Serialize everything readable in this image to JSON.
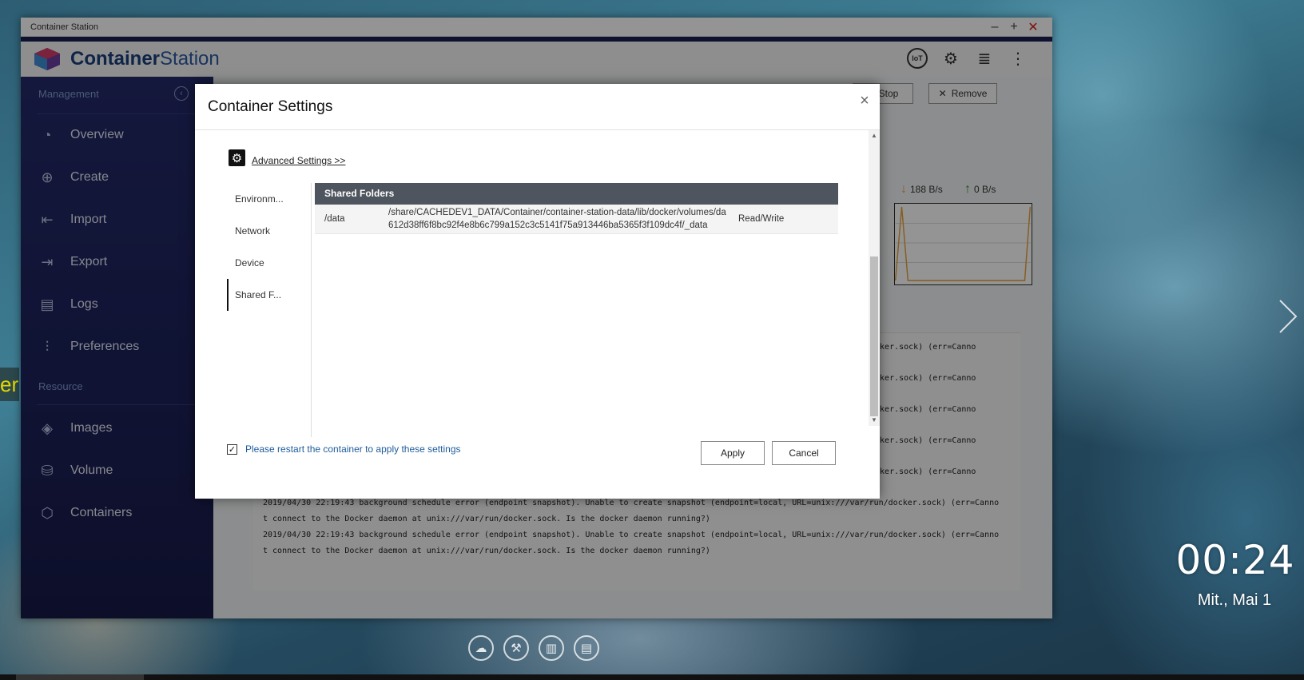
{
  "window": {
    "title": "Container Station"
  },
  "app": {
    "brand_bold": "Container",
    "brand_light": "Station"
  },
  "header": {
    "iot_label": "IoT"
  },
  "sidebar": {
    "section_management": "Management",
    "section_resource": "Resource",
    "items": [
      {
        "label": "Overview",
        "icon": "gauge-icon"
      },
      {
        "label": "Create",
        "icon": "plus-circle-icon"
      },
      {
        "label": "Import",
        "icon": "import-icon"
      },
      {
        "label": "Export",
        "icon": "export-icon"
      },
      {
        "label": "Logs",
        "icon": "document-icon"
      },
      {
        "label": "Preferences",
        "icon": "sliders-icon"
      }
    ],
    "resource_items": [
      {
        "label": "Images",
        "icon": "layers-icon"
      },
      {
        "label": "Volume",
        "icon": "cylinder-icon"
      },
      {
        "label": "Containers",
        "icon": "cube-icon"
      }
    ]
  },
  "toolbar": {
    "stop_label": "Stop",
    "remove_label": "Remove"
  },
  "traffic": {
    "down": "188 B/s",
    "up": "0 B/s",
    "down_color": "#e6a23c",
    "up_color": "#2e9c3a"
  },
  "logs": [
    "ocker.sock) (err=Canno",
    "ocker.sock) (err=Canno",
    "ocker.sock) (err=Canno",
    "ocker.sock) (err=Canno",
    "ocker.sock) (err=Canno",
    "2019/04/30 22:19:43 background schedule error (endpoint snapshot). Unable to create snapshot (endpoint=local, URL=unix:///var/run/docker.sock) (err=Canno",
    "t connect to the Docker daemon at unix:///var/run/docker.sock. Is the docker daemon running?)",
    "2019/04/30 22:19:43 background schedule error (endpoint snapshot). Unable to create snapshot (endpoint=local, URL=unix:///var/run/docker.sock) (err=Canno",
    "t connect to the Docker daemon at unix:///var/run/docker.sock. Is the docker daemon running?)"
  ],
  "dialog": {
    "title": "Container Settings",
    "advanced_link": "Advanced Settings >>",
    "tabs": [
      "Environm...",
      "Network",
      "Device",
      "Shared F..."
    ],
    "active_tab": 3,
    "shared_folders": {
      "header": "Shared Folders",
      "rows": [
        {
          "mount": "/data",
          "path": "/share/CACHEDEV1_DATA/Container/container-station-data/lib/docker/volumes/da612d38ff6f8bc92f4e8b6c799a152c3c5141f75a913446ba5365f3f109dc4f/_data",
          "permission": "Read/Write"
        }
      ]
    },
    "restart_message": "Please restart the container to apply these settings",
    "restart_checked": true,
    "apply_label": "Apply",
    "cancel_label": "Cancel"
  },
  "desktop": {
    "clock": "00:24",
    "date": "Mit., Mai 1",
    "wallpaper_fragment": "er"
  }
}
